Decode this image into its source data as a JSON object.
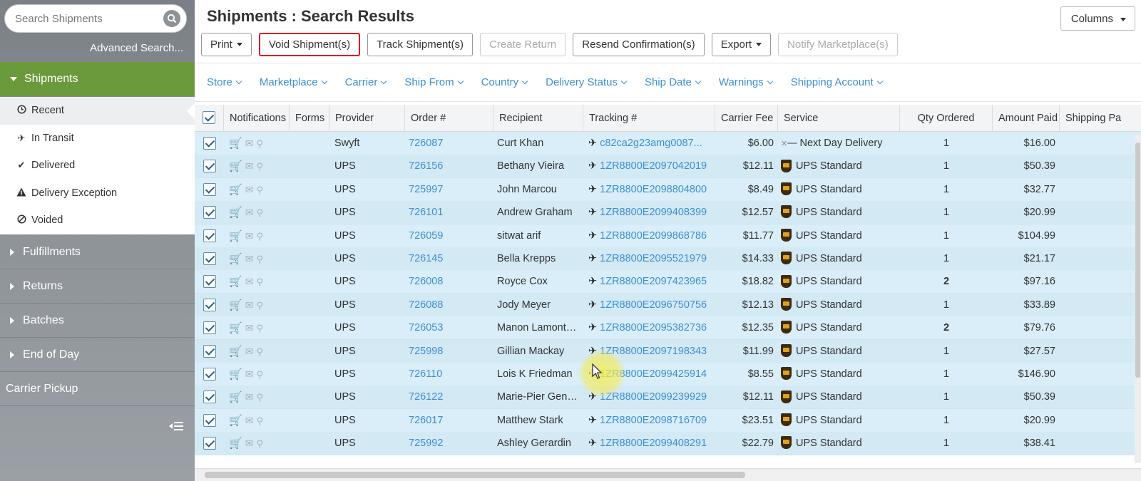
{
  "search": {
    "placeholder": "Search Shipments",
    "advanced_label": "Advanced Search..."
  },
  "sidebar": {
    "sections": [
      {
        "label": "Shipments",
        "expanded": true
      },
      {
        "label": "Fulfillments"
      },
      {
        "label": "Returns"
      },
      {
        "label": "Batches"
      },
      {
        "label": "End of Day"
      }
    ],
    "shipment_items": [
      {
        "label": "Recent",
        "icon": "clock-icon",
        "active": true
      },
      {
        "label": "In Transit",
        "icon": "plane-icon"
      },
      {
        "label": "Delivered",
        "icon": "check-icon"
      },
      {
        "label": "Delivery Exception",
        "icon": "warning-icon"
      },
      {
        "label": "Voided",
        "icon": "ban-icon"
      }
    ],
    "carrier_pickup": "Carrier Pickup"
  },
  "header": {
    "title": "Shipments : Search Results",
    "columns_label": "Columns"
  },
  "toolbar": {
    "print": "Print",
    "void": "Void Shipment(s)",
    "track": "Track Shipment(s)",
    "create_return": "Create Return",
    "resend": "Resend Confirmation(s)",
    "export": "Export",
    "notify": "Notify Marketplace(s)"
  },
  "filters": [
    "Store",
    "Marketplace",
    "Carrier",
    "Ship From",
    "Country",
    "Delivery Status",
    "Ship Date",
    "Warnings",
    "Shipping Account"
  ],
  "columns": {
    "notifications": "Notifications",
    "forms": "Forms",
    "provider": "Provider",
    "order": "Order #",
    "recipient": "Recipient",
    "tracking": "Tracking #",
    "carrier_fee": "Carrier Fee",
    "service": "Service",
    "qty": "Qty Ordered",
    "amount": "Amount Paid",
    "shipping_paid": "Shipping Pa"
  },
  "rows": [
    {
      "provider": "Swyft",
      "order": "726087",
      "recipient": "Curt Khan",
      "tracking": "c82ca2g23amg0087...",
      "fee": "$6.00",
      "service": "Next Day Delivery",
      "service_icon": "swyft-icon",
      "qty": "1",
      "amount": "$16.00"
    },
    {
      "provider": "UPS",
      "order": "726156",
      "recipient": "Bethany Vieira",
      "tracking": "1ZR8800E2097042019",
      "fee": "$12.11",
      "service": "UPS Standard",
      "service_icon": "ups-icon",
      "qty": "1",
      "amount": "$50.39"
    },
    {
      "provider": "UPS",
      "order": "725997",
      "recipient": "John Marcou",
      "tracking": "1ZR8800E2098804800",
      "fee": "$8.49",
      "service": "UPS Standard",
      "service_icon": "ups-icon",
      "qty": "1",
      "amount": "$32.77"
    },
    {
      "provider": "UPS",
      "order": "726101",
      "recipient": "Andrew Graham",
      "tracking": "1ZR8800E2099408399",
      "fee": "$12.57",
      "service": "UPS Standard",
      "service_icon": "ups-icon",
      "qty": "1",
      "amount": "$20.99"
    },
    {
      "provider": "UPS",
      "order": "726059",
      "recipient": "sitwat arif",
      "tracking": "1ZR8800E2099868786",
      "fee": "$11.77",
      "service": "UPS Standard",
      "service_icon": "ups-icon",
      "qty": "1",
      "amount": "$104.99"
    },
    {
      "provider": "UPS",
      "order": "726145",
      "recipient": "Bella Krepps",
      "tracking": "1ZR8800E2095521979",
      "fee": "$14.33",
      "service": "UPS Standard",
      "service_icon": "ups-icon",
      "qty": "1",
      "amount": "$21.17"
    },
    {
      "provider": "UPS",
      "order": "726008",
      "recipient": "Royce Cox",
      "tracking": "1ZR8800E2097423965",
      "fee": "$18.82",
      "service": "UPS Standard",
      "service_icon": "ups-icon",
      "qty": "2",
      "amount": "$97.16"
    },
    {
      "provider": "UPS",
      "order": "726088",
      "recipient": "Jody Meyer",
      "tracking": "1ZR8800E2096750756",
      "fee": "$12.13",
      "service": "UPS Standard",
      "service_icon": "ups-icon",
      "qty": "1",
      "amount": "$33.89"
    },
    {
      "provider": "UPS",
      "order": "726053",
      "recipient": "Manon Lamontagne",
      "tracking": "1ZR8800E2095382736",
      "fee": "$12.35",
      "service": "UPS Standard",
      "service_icon": "ups-icon",
      "qty": "2",
      "amount": "$79.76"
    },
    {
      "provider": "UPS",
      "order": "725998",
      "recipient": "Gillian Mackay",
      "tracking": "1ZR8800E2097198343",
      "fee": "$11.99",
      "service": "UPS Standard",
      "service_icon": "ups-icon",
      "qty": "1",
      "amount": "$27.57"
    },
    {
      "provider": "UPS",
      "order": "726110",
      "recipient": "Lois K Friedman",
      "tracking": "1ZR8800E2099425914",
      "fee": "$8.55",
      "service": "UPS Standard",
      "service_icon": "ups-icon",
      "qty": "1",
      "amount": "$146.90"
    },
    {
      "provider": "UPS",
      "order": "726122",
      "recipient": "Marie-Pier Gendron",
      "tracking": "1ZR8800E2099239929",
      "fee": "$12.11",
      "service": "UPS Standard",
      "service_icon": "ups-icon",
      "qty": "1",
      "amount": "$50.39"
    },
    {
      "provider": "UPS",
      "order": "726017",
      "recipient": "Matthew Stark",
      "tracking": "1ZR8800E2098716709",
      "fee": "$23.51",
      "service": "UPS Standard",
      "service_icon": "ups-icon",
      "qty": "1",
      "amount": "$20.99"
    },
    {
      "provider": "UPS",
      "order": "725992",
      "recipient": "Ashley Gerardin",
      "tracking": "1ZR8800E2099408291",
      "fee": "$22.79",
      "service": "UPS Standard",
      "service_icon": "ups-icon",
      "qty": "1",
      "amount": "$38.41"
    }
  ],
  "colors": {
    "accent_green": "#6b9a3c",
    "link_blue": "#3d8fd1",
    "selected_row": "#d9eef8",
    "highlight_red": "#e0171f"
  }
}
